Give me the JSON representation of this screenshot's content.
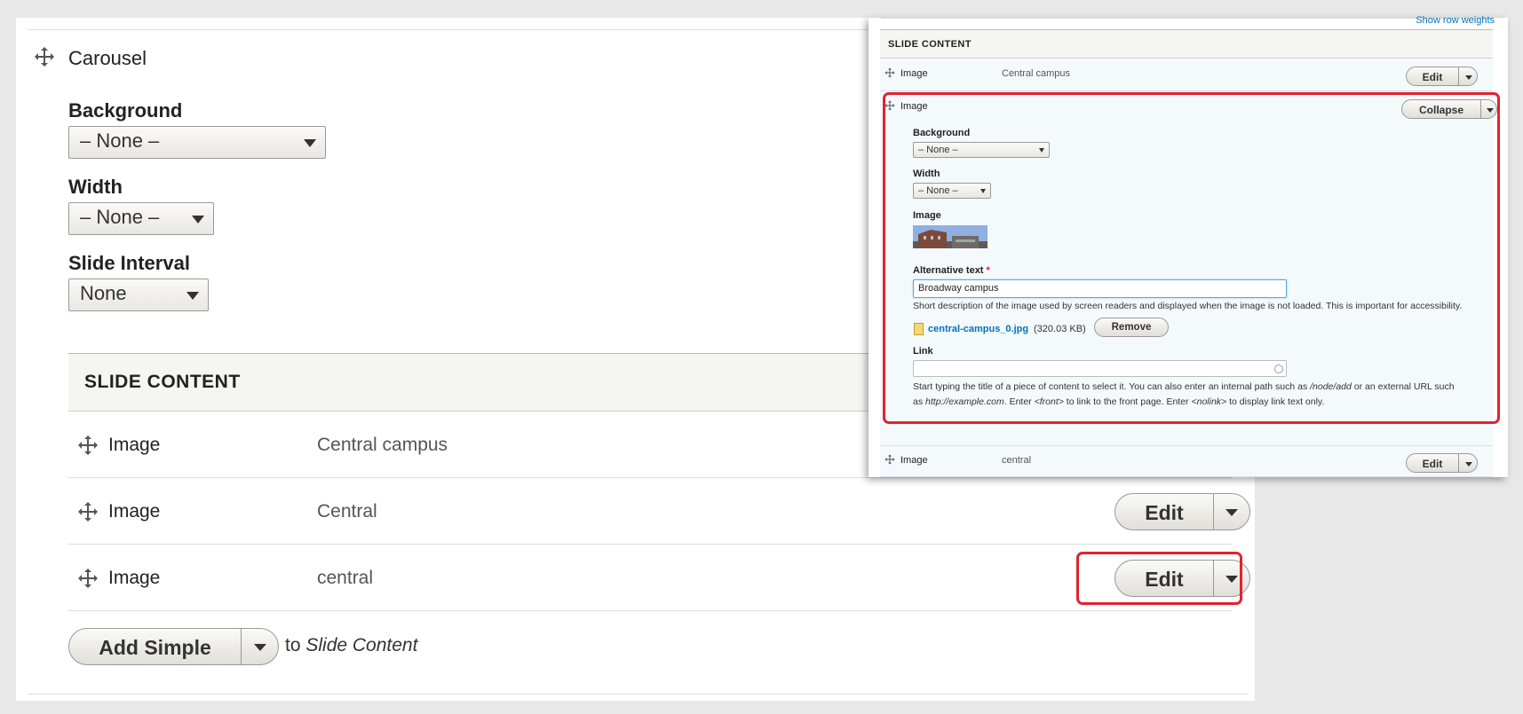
{
  "main": {
    "section_title": "Carousel",
    "background": {
      "label": "Background",
      "value": "– None –"
    },
    "width": {
      "label": "Width",
      "value": "– None –"
    },
    "slide_interval": {
      "label": "Slide Interval",
      "value": "None"
    },
    "slide_content_header": "SLIDE CONTENT",
    "rows": [
      {
        "type": "Image",
        "value": "Central campus"
      },
      {
        "type": "Image",
        "value": "Central",
        "button": "Edit"
      },
      {
        "type": "Image",
        "value": "central",
        "button": "Edit"
      }
    ],
    "add_button": "Add Simple",
    "add_to_prefix": "to",
    "add_to_target": "Slide Content"
  },
  "overlay": {
    "show_row_weights": "Show row weights",
    "slide_content_header": "SLIDE CONTENT",
    "row_top": {
      "type": "Image",
      "value": "Central campus",
      "button": "Edit"
    },
    "expanded": {
      "type": "Image",
      "collapse_button": "Collapse",
      "background": {
        "label": "Background",
        "value": "– None –"
      },
      "width": {
        "label": "Width",
        "value": "– None –"
      },
      "image_label": "Image",
      "alt_text": {
        "label": "Alternative text",
        "required_marker": "*",
        "value": "Broadway campus",
        "description": "Short description of the image used by screen readers and displayed when the image is not loaded. This is important for accessibility."
      },
      "file": {
        "name": "central-campus_0.jpg",
        "size": "(320.03 KB)",
        "remove_button": "Remove"
      },
      "link": {
        "label": "Link",
        "value": "",
        "desc_1": "Start typing the title of a piece of content to select it. You can also enter an internal path such as",
        "desc_node_add": "/node/add",
        "desc_2": "or an external URL such",
        "desc_3": "as",
        "desc_example": "http://example.com",
        "desc_4": ". Enter",
        "desc_front": "<front>",
        "desc_5": "to link to the front page. Enter",
        "desc_nolink": "<nolink>",
        "desc_6": "to display link text only."
      }
    },
    "row_bottom": {
      "type": "Image",
      "value": "central",
      "button": "Edit"
    }
  },
  "colors": {
    "highlight": "#e0232e",
    "link": "#0074bd",
    "row_bg": "#f4f9fc"
  },
  "icons": {
    "drag": "move-arrows-icon",
    "dropdown": "caret-down-icon",
    "file": "image-file-icon"
  }
}
